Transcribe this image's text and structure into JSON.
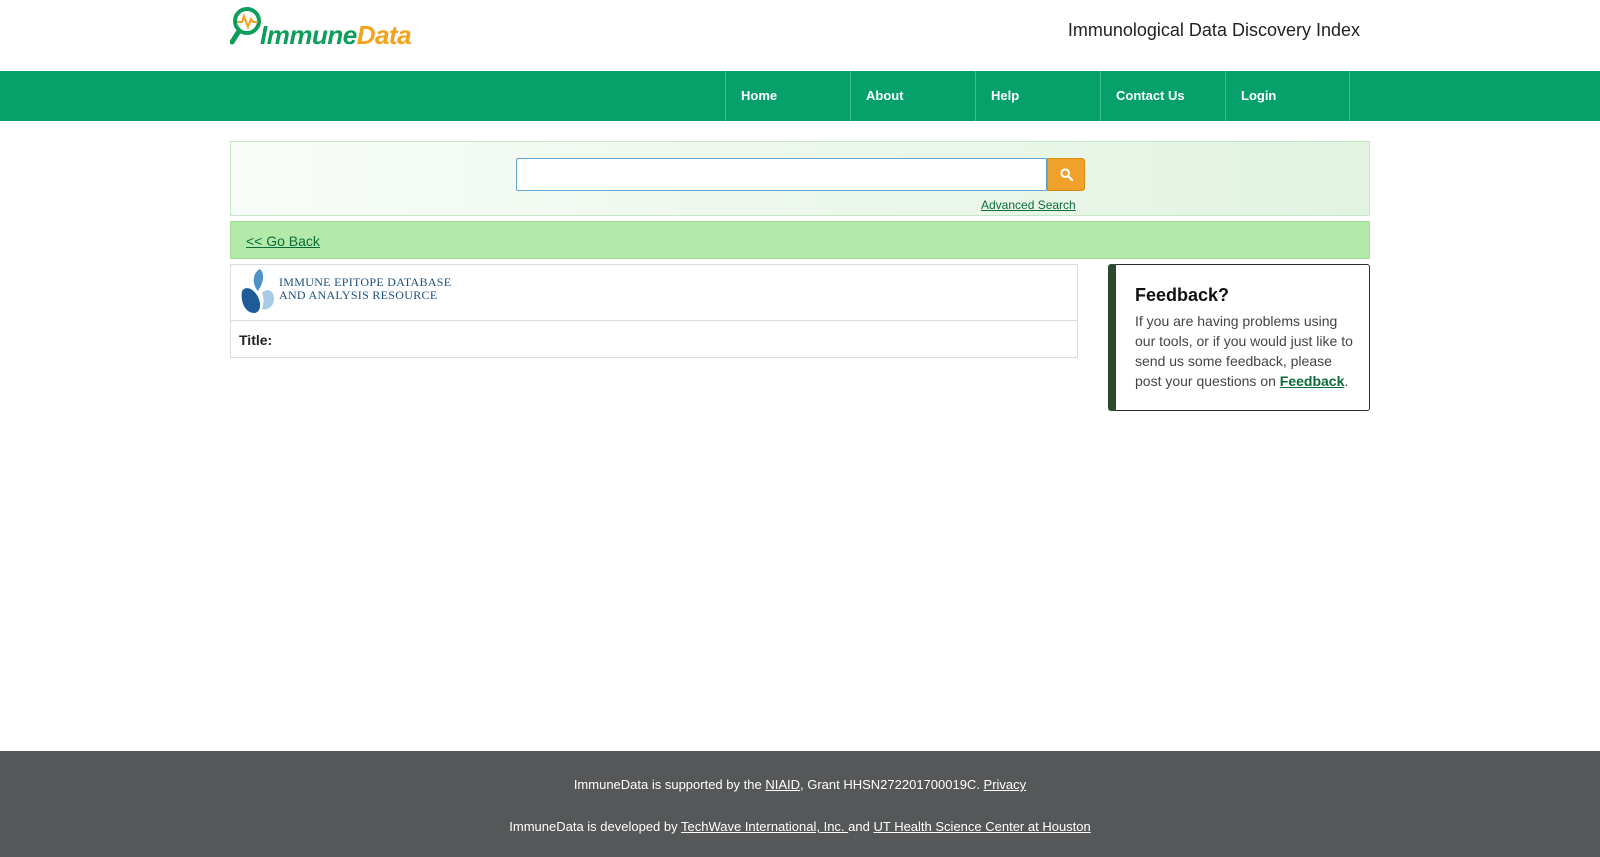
{
  "header": {
    "logo": {
      "immune": "Immune",
      "data": "Data"
    },
    "site_title": "Immunological Data Discovery Index"
  },
  "nav": {
    "items": [
      {
        "label": "Home"
      },
      {
        "label": "About"
      },
      {
        "label": "Help"
      },
      {
        "label": "Contact Us"
      },
      {
        "label": "Login"
      }
    ]
  },
  "search": {
    "value": "",
    "placeholder": "",
    "button_icon": "search-icon",
    "advanced_link": "Advanced Search"
  },
  "goback": {
    "label": "<< Go Back"
  },
  "result": {
    "source_logo_line1": "IMMUNE EPITOPE DATABASE",
    "source_logo_line2": "AND ANALYSIS RESOURCE",
    "title_label": "Title:",
    "title_value": ""
  },
  "feedback": {
    "title": "Feedback?",
    "text": "If you are having problems using our tools, or if you would just like to send us some feedback, please post your questions on ",
    "link": "Feedback",
    "trailing": "."
  },
  "footer": {
    "line1_pre": "ImmuneData is supported by the ",
    "niaid": "NIAID",
    "line1_mid": ", Grant HHSN272201700019C. ",
    "privacy": "Privacy",
    "line2_pre": "ImmuneData is developed by ",
    "techwave": "TechWave International, Inc. ",
    "line2_mid": "and ",
    "uthealth": "UT Health Science Center at Houston"
  },
  "colors": {
    "nav_green": "#06a06b",
    "search_orange": "#f0a12a",
    "goback_bar": "#b3eaaa",
    "link_green": "#0b6b3a",
    "footer_gray": "#555758"
  }
}
